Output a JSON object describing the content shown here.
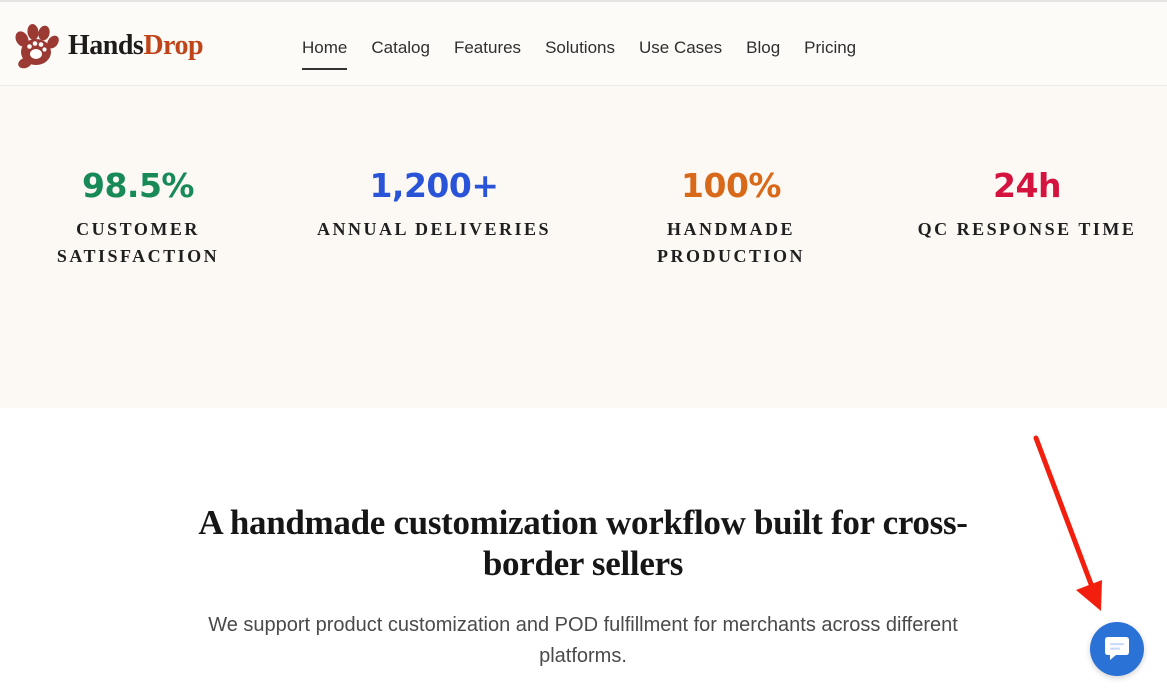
{
  "brand": {
    "name_part1": "Hands",
    "name_part2": "Drop",
    "logo_icon": "paw-hand-icon"
  },
  "nav": {
    "items": [
      {
        "label": "Home",
        "active": true
      },
      {
        "label": "Catalog"
      },
      {
        "label": "Features"
      },
      {
        "label": "Solutions"
      },
      {
        "label": "Use Cases"
      },
      {
        "label": "Blog"
      },
      {
        "label": "Pricing"
      }
    ]
  },
  "stats": [
    {
      "value": "98.5%",
      "label_lines": [
        "CUSTOMER",
        "SATISFACTION"
      ],
      "color": "#178a57"
    },
    {
      "value": "1,200+",
      "label_lines": [
        "ANNUAL DELIVERIES"
      ],
      "color": "#2a54d8"
    },
    {
      "value": "100%",
      "label_lines": [
        "HANDMADE",
        "PRODUCTION"
      ],
      "color": "#d9691a"
    },
    {
      "value": "24h",
      "label_lines": [
        "QC RESPONSE TIME"
      ],
      "color": "#d4133f"
    }
  ],
  "section": {
    "headline_line1": "A handmade customization workflow built for cross-",
    "headline_line2": "border sellers",
    "subtext_line1": "We support product customization and POD fulfillment for merchants across different",
    "subtext_line2": "platforms."
  },
  "chat": {
    "icon": "chat-bubble-icon",
    "color": "#2a72d6"
  },
  "annotation": {
    "arrow_color": "#f21f0f"
  }
}
